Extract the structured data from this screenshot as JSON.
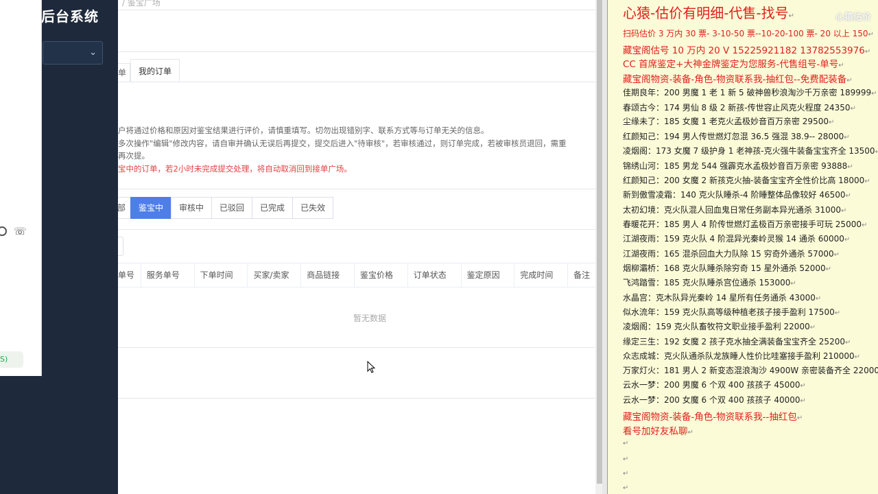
{
  "sidebar": {
    "title": "后台系统",
    "chevron": "⌄",
    "popup": {
      "phone_icon": "☏",
      "pill_label": "S)"
    }
  },
  "main": {
    "breadcrumb": "/ 鉴宝广场",
    "tab_prev": "单",
    "tab_active": "我的订单",
    "notes": [
      "户将通过价格和原因对鉴宝结果进行评价，请慎重填写。切勿出现错别字、联系方式等与订单无关的信息。",
      "多次操作\"编辑\"修改内容，请自审并确认无误后再提交，提交后进入\"待审核\"，若审核通过，则订单完成，若被审核员退回，需重",
      "再次提。",
      "宝中的订单，若2小时未完成提交处理，将自动取消回到接单广场。"
    ],
    "filters": [
      "部",
      "鉴宝中",
      "审核中",
      "已驳回",
      "已完成",
      "已失效"
    ],
    "filter_active_index": 1,
    "table_headers": [
      "单号",
      "服务单号",
      "下单时间",
      "买家/卖家",
      "商品链接",
      "鉴宝价格",
      "订单状态",
      "鉴定原因",
      "完成时间",
      "备注"
    ],
    "empty_text": "暂无数据"
  },
  "notepad": {
    "watermark": "心猿估价",
    "lines": [
      {
        "text": "心猿-估价有明细-代售-找号",
        "style": "red big"
      },
      {
        "text": "扫码估价 3 万内 30 票- 3-10-50 票--10-20-100 票- 20 以上 150",
        "style": "red"
      },
      {
        "text": "藏宝阁估号 10 万内 20 V 15225921182   13782553976",
        "style": "red mid"
      },
      {
        "text": "CC 首席鉴定+大神金牌鉴定为您服务-代售组号-单号",
        "style": "red mid"
      },
      {
        "text": "藏宝阁物资-装备-角色-物资联系我-抽红包--免费配装备",
        "style": "red mid"
      },
      {
        "text": "佳期良年：200 男魔 1 老 1 新 5 破神兽秒浪淘沙千万亲密 189999",
        "style": ""
      },
      {
        "text": "春颂古今：174 男仙 8 级 2 新孩-传世容止风克火程度 24350",
        "style": ""
      },
      {
        "text": "尘缘未了：185 女魔 1 老克火孟极妙音百万亲密 29500",
        "style": ""
      },
      {
        "text": "红颜知己：194 男人传世燃灯忽混 36.5 强混 38.9-- 28000",
        "style": ""
      },
      {
        "text": "凌烟阁：173 女魔 7 级护身 1 老神孩-克火强牛装备宝宝齐全 13500",
        "style": ""
      },
      {
        "text": "锦绣山河：185 男龙 544 强霹克水孟极妙音百万亲密 93888",
        "style": ""
      },
      {
        "text": "红颜知己：200 女魔 2 新孩克火抽-装备宝宝齐全性价比高 18000",
        "style": ""
      },
      {
        "text": "新到傲雪凌霜：140 克火队睡杀-4 阶睡整体品像较好 46500",
        "style": ""
      },
      {
        "text": "太初幻境：克火队混人回血鬼日常任务副本异光通杀 31000",
        "style": ""
      },
      {
        "text": "春暖花开：185 男人 4 阶传世燃灯孟极百万亲密接手可玩 25000",
        "style": ""
      },
      {
        "text": "江湖夜雨：159 克火队 4 阶混异光秦岭灵猴 14 通杀 60000",
        "style": ""
      },
      {
        "text": "江湖夜雨：165 混杀回血大力队除 15 穷奇外通杀 57000",
        "style": ""
      },
      {
        "text": "烟柳灞桥：168 克火队睡杀除穷奇 15 星外通杀 52000",
        "style": ""
      },
      {
        "text": "飞鸿踏雪：185 克火队睡杀宫位通杀 153000",
        "style": ""
      },
      {
        "text": "水晶宫：克木队异光秦岭 14 星所有任务通杀 43000",
        "style": ""
      },
      {
        "text": "似水流年：159 克火队高等级种植老孩子接手盈利 17500",
        "style": ""
      },
      {
        "text": "凌烟阁：159 克火队畜牧符文职业接手盈利 22000",
        "style": ""
      },
      {
        "text": "缘定三生：192 女魔 2 孩子克水抽全满装备宝宝齐全 25200",
        "style": ""
      },
      {
        "text": "众志成城：克火队通杀队龙族睡人性价比哇塞接手盈利 210000",
        "style": ""
      },
      {
        "text": "万家灯火：181 男人 2 新变态混浪淘沙 4900W 亲密装备齐全 220000",
        "style": ""
      },
      {
        "text": "云水一梦：200 男魔 6 个双 400 孩孩子 45000",
        "style": ""
      },
      {
        "text": "云水一梦：200 女魔 6 个双 400 孩孩子 40000",
        "style": ""
      },
      {
        "text": "藏宝阁物资-装备-角色-物资联系我--抽红包",
        "style": "red mid"
      },
      {
        "text": "看号加好友私聊",
        "style": "red mid"
      }
    ],
    "return_mark": "↵"
  }
}
